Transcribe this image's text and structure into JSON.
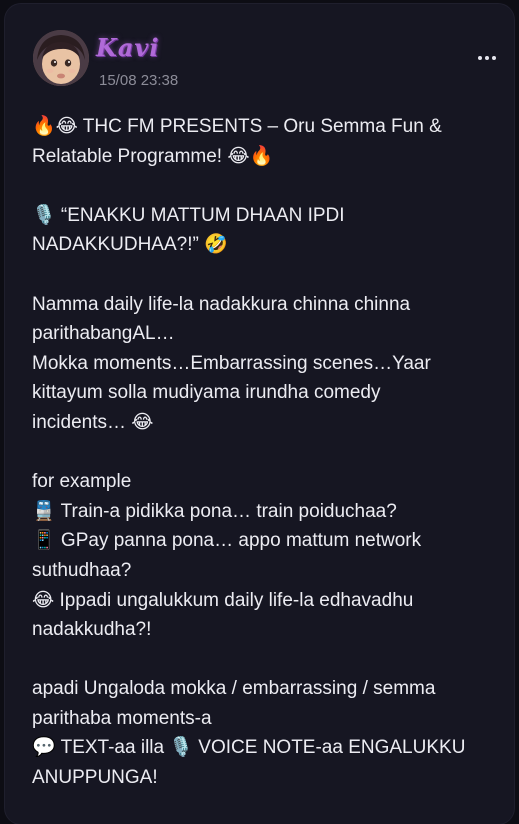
{
  "post": {
    "author": "Kavi",
    "timestamp": "15/08 23:38",
    "more_icon": "more-horizontal-icon",
    "avatar_icon": "child-photo-avatar",
    "lines": [
      "🔥😂 THC FM PRESENTS – Oru Semma Fun &",
      "Relatable Programme! 😂🔥",
      "",
      "🎙️ “ENAKKU MATTUM DHAAN IPDI",
      "NADAKKUDHAA?!” 🤣",
      "",
      "Namma daily life-la nadakkura chinna chinna",
      "parithabangAL…",
      "Mokka moments…Embarrassing scenes…Yaar",
      "kittayum solla mudiyama irundha comedy",
      "incidents… 😂",
      "",
      "for example",
      "🚆 Train-a pidikka pona… train poiduchaa?",
      "📱 GPay panna pona… appo mattum network",
      "suthudhaa?",
      "😂 Ippadi ungalukkum daily life-la edhavadhu",
      "nadakkudha?!",
      "",
      "apadi Ungaloda mokka / embarrassing / semma",
      "parithaba moments-a",
      "💬 TEXT-aa illa 🎙️ VOICE NOTE-aa ENGALUKKU",
      "ANUPPUNGA!"
    ]
  },
  "colors": {
    "background": "#0d0d14",
    "card": "#161622",
    "author_name": "#b06ad8",
    "text": "#ececf2",
    "muted": "#8c8c98"
  }
}
